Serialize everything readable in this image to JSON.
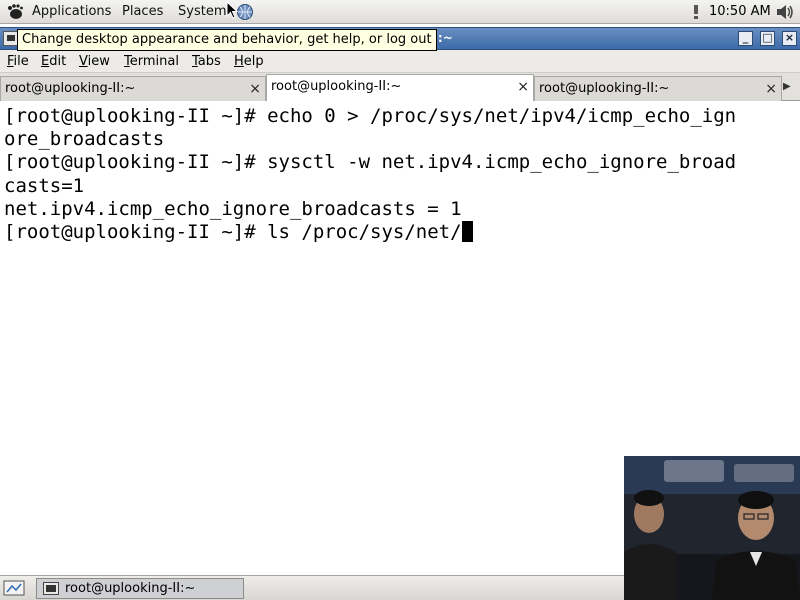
{
  "top_panel": {
    "menus": [
      "Applications",
      "Places",
      "System"
    ],
    "clock": "10:50 AM"
  },
  "tooltip": "Change desktop appearance and behavior, get help, or log out",
  "window": {
    "title": "root@uplooking-II:~",
    "title_visible_fragment": "-II:~",
    "buttons": [
      "minimize",
      "maximize",
      "close"
    ]
  },
  "menu_bar": [
    "File",
    "Edit",
    "View",
    "Terminal",
    "Tabs",
    "Help"
  ],
  "tabs": [
    {
      "label": "root@uplooking-II:~",
      "active": false
    },
    {
      "label": "root@uplooking-II:~",
      "active": true
    },
    {
      "label": "root@uplooking-II:~",
      "active": false
    }
  ],
  "terminal": {
    "lines": [
      "[root@uplooking-II ~]# echo 0 > /proc/sys/net/ipv4/icmp_echo_ign",
      "ore_broadcasts",
      "[root@uplooking-II ~]# sysctl -w net.ipv4.icmp_echo_ignore_broad",
      "casts=1",
      "net.ipv4.icmp_echo_ignore_broadcasts = 1",
      "[root@uplooking-II ~]# ls /proc/sys/net/"
    ]
  },
  "taskbar": {
    "window_label": "root@uplooking-II:~"
  },
  "colors": {
    "title_bar": "#3c6aa8",
    "tooltip_bg": "#ffffe1",
    "terminal_bg": "#ffffff",
    "terminal_fg": "#000000"
  },
  "icons": [
    "gnome-foot-icon",
    "network-icon",
    "volume-icon",
    "terminal-icon",
    "show-desktop-icon"
  ]
}
